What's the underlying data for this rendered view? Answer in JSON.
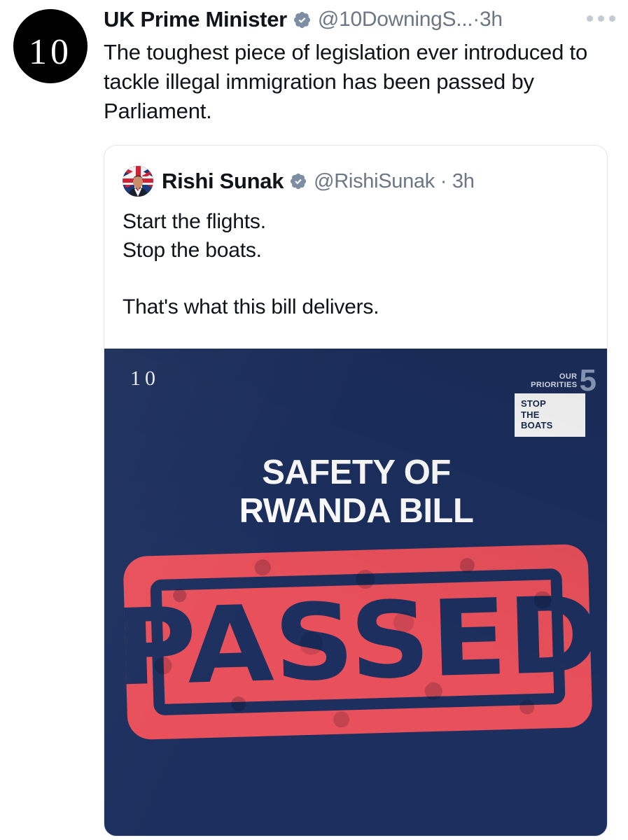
{
  "main_tweet": {
    "avatar_label": "10",
    "display_name": "UK Prime Minister",
    "verified_icon": "verified-badge-icon",
    "handle": "@10DowningS...",
    "separator": "·",
    "timestamp": "3h",
    "more_icon": "more-options-icon",
    "text": "The toughest piece of legislation ever introduced to tackle illegal immigration has been passed by Parliament."
  },
  "quoted_tweet": {
    "avatar_label": "rishi-sunak-avatar",
    "display_name": "Rishi Sunak",
    "verified_icon": "verified-badge-icon",
    "handle": "@RishiSunak",
    "separator": "·",
    "timestamp": "3h",
    "text": "Start the flights.\nStop the boats.\n\nThat's what this bill delivers.",
    "media": {
      "logo": "10",
      "priorities": {
        "line1": "OUR",
        "line2": "PRIORITIES",
        "number": "5",
        "box_line1": "STOP",
        "box_line2": "THE",
        "box_line3": "BOATS"
      },
      "headline_line1": "SAFETY OF",
      "headline_line2": "RWANDA BILL",
      "stamp_text": "PASSED"
    }
  },
  "colors": {
    "navy": "#1c2f5e",
    "stamp_red": "#e8505b",
    "text": "#0f1419",
    "muted": "#6b7785",
    "verified": "#7b8ea3",
    "card_border": "#e2e6ea"
  }
}
